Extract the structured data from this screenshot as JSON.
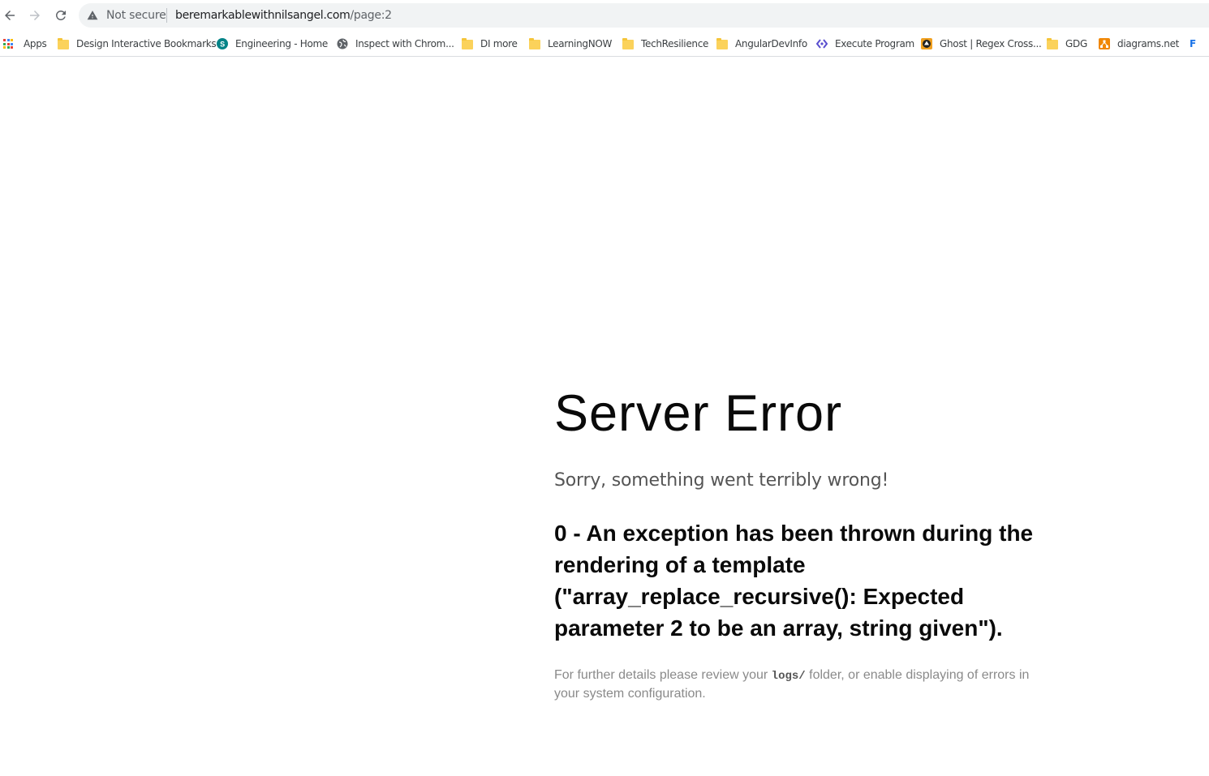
{
  "browser": {
    "security_label": "Not secure",
    "url_host": "beremarkablewithnilsangel.com",
    "url_path": "/page:2"
  },
  "bookmarks": {
    "items": [
      {
        "label": "Apps",
        "icon": "apps-grid-icon"
      },
      {
        "label": "Design Interactive Bookmarks",
        "icon": "folder-icon"
      },
      {
        "label": "Engineering - Home",
        "icon": "sharepoint-icon"
      },
      {
        "label": "Inspect with Chrom...",
        "icon": "globe-icon"
      },
      {
        "label": "DI more",
        "icon": "folder-icon"
      },
      {
        "label": "LearningNOW",
        "icon": "folder-icon"
      },
      {
        "label": "TechResilience",
        "icon": "folder-icon"
      },
      {
        "label": "AngularDevInfo",
        "icon": "folder-icon"
      },
      {
        "label": "Execute Program",
        "icon": "execute-program-icon"
      },
      {
        "label": "Ghost | Regex Cross...",
        "icon": "regex-crossword-icon"
      },
      {
        "label": "GDG",
        "icon": "folder-icon"
      },
      {
        "label": "diagrams.net",
        "icon": "diagrams-net-icon"
      },
      {
        "label": "F",
        "icon": "overflow-bookmark-icon"
      }
    ]
  },
  "error_page": {
    "title": "Server Error",
    "subtitle": "Sorry, something went terribly wrong!",
    "message": "0 - An exception has been thrown during the rendering of a template (\"array_replace_recursive(): Expected parameter 2 to be an array, string given\").",
    "note_before": "For further details please review your ",
    "note_code": "logs/",
    "note_after": " folder, or enable displaying of errors in your system configuration."
  },
  "colors": {
    "folder": "#fbd25b",
    "sharepoint": "#038387",
    "execute_program": "#5a4fcf",
    "diagrams": "#f08705"
  }
}
